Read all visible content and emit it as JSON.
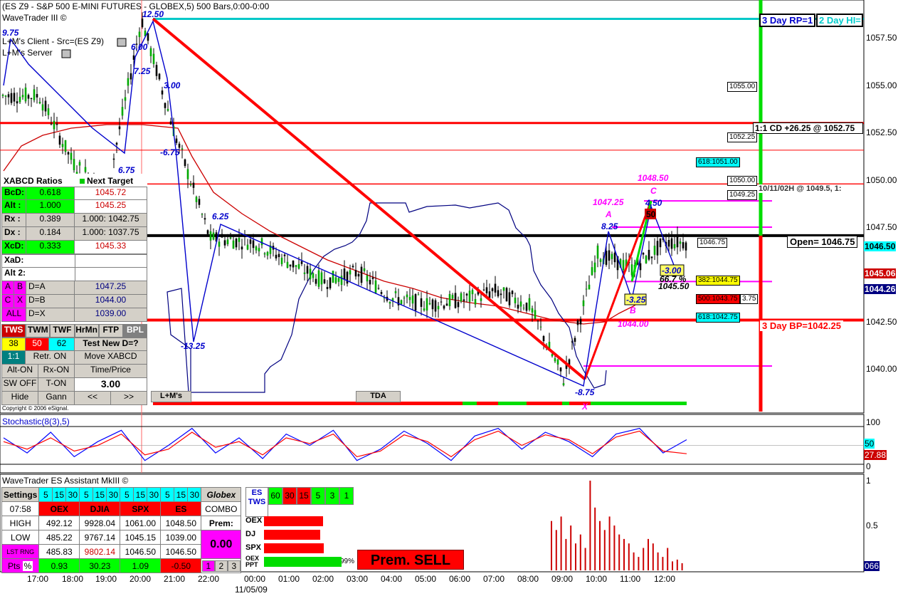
{
  "chart_data": [
    {
      "type": "line",
      "title": "(ES Z9 - S&P 500 E-MINI FUTURES - GLOBEX,5) 500 Bars,0:00-0:00",
      "xlabel": "",
      "ylabel": "",
      "ylim": [
        1037.6,
        1059.0
      ],
      "grid": false,
      "legend": "none",
      "x": [
        "17:00",
        "18:00",
        "19:00",
        "20:00",
        "21:00",
        "22:00",
        "00:00",
        "01:00",
        "02:00",
        "03:00",
        "04:00",
        "05:00",
        "06:00",
        "07:00",
        "08:00",
        "09:00",
        "10:00",
        "11:00",
        "12:00"
      ],
      "y_ticks": [
        "1057.50",
        "1055.00",
        "1052.50",
        "1050.00",
        "1047.50",
        "1046.50",
        "1045.06",
        "1044.26",
        "1042.50",
        "1040.00"
      ],
      "series": [
        {
          "name": "",
          "values": [
            1054.2,
            1050.6,
            1049.2,
            1058.3,
            1052.0,
            1046.6,
            1046.4,
            1045.3,
            1044.3,
            1044.8,
            1043.4,
            1043.1,
            1043.3,
            1043.8,
            1043.0,
            1039.1,
            1045.8,
            1045.0,
            1046.4
          ]
        }
      ],
      "levels": [
        {
          "label": "3 Day RP=1",
          "value": 1058.3,
          "color": "#00c8c8"
        },
        {
          "label": "2 Day HI=",
          "value": 1058.3,
          "color": "#00c8c8"
        },
        {
          "label": "1:1 CD +26.25 @ 1052.75",
          "value": 1052.75,
          "color": "#ff0000"
        },
        {
          "label": "10/11/02H @ 1049.5, 1:",
          "value": 1049.5,
          "color": "#ff0000"
        },
        {
          "label": "Open= 1046.75",
          "value": 1046.75,
          "color": "#000000"
        },
        {
          "label": "3 Day BP=1042.25",
          "value": 1042.25,
          "color": "#ff0000"
        }
      ],
      "annotations": [
        "12.50",
        "9.75",
        "6.00",
        "7.25",
        "3.00",
        "-6.75",
        "6.75",
        "6.25",
        "-13.25",
        "-8.75",
        "1047.25",
        "A",
        "8.25",
        "1048.50",
        "C",
        "4.50",
        "50",
        "-3.00",
        "66.7 %",
        "1045.50",
        "-3.25",
        "B",
        "1044.00",
        "X",
        "-3.25"
      ],
      "price_tags": [
        "1055.00",
        "1052.25",
        "618:1051.00",
        "1050.00",
        "1049.25",
        "1046.75",
        "382:1044.75",
        "500:1043.75",
        "3.75",
        "618:1042.75"
      ]
    },
    {
      "type": "line",
      "title": "Stochastic(8(3),5)",
      "xlabel": "",
      "ylabel": "",
      "ylim": [
        0,
        100
      ],
      "y_ticks": [
        "100",
        "50",
        "27.88",
        "0"
      ],
      "series": [
        {
          "name": "",
          "color": "#0000ff",
          "values": [
            70,
            30,
            85,
            20,
            60,
            90,
            10,
            50,
            95,
            30,
            70,
            15,
            80,
            50,
            90,
            10,
            40,
            88,
            55,
            10,
            75,
            95,
            40,
            85,
            60,
            20,
            80,
            95,
            30,
            65
          ]
        },
        {
          "name": "",
          "color": "#ff0000",
          "values": [
            60,
            40,
            70,
            35,
            50,
            80,
            25,
            40,
            85,
            45,
            60,
            25,
            70,
            55,
            80,
            20,
            35,
            78,
            60,
            20,
            65,
            88,
            50,
            78,
            65,
            28,
            72,
            88,
            35,
            28
          ]
        }
      ]
    },
    {
      "type": "bar",
      "title": "WaveTrader ES Assistant MkIII ©",
      "xlabel": "",
      "ylabel": "",
      "ylim": [
        0,
        1
      ],
      "y_ticks": [
        "1",
        "0.5",
        "066"
      ],
      "values": [
        0.55,
        0.45,
        0.6,
        0.35,
        0.5,
        0.3,
        0.4,
        0.25,
        1.0,
        0.7,
        0.55,
        0.45,
        0.6,
        0.5,
        0.4,
        0.35,
        0.3,
        0.2,
        0.15,
        0.25,
        0.35,
        0.3,
        0.2,
        0.15,
        0.25,
        0.1,
        0.12,
        0.08
      ]
    }
  ],
  "header": {
    "title": "(ES Z9 - S&P 500 E-MINI FUTURES - GLOBEX,5) 500 Bars,0:00-0:00",
    "app": "WaveTrader III ©",
    "client": "L+M's Client - Src=(ES Z9)",
    "server": "L+M's Server",
    "copyright": "Copyright © 2006 eSignal."
  },
  "bottom_buttons": {
    "lm": "L+M's",
    "tda": "TDA"
  },
  "xabcd": {
    "title": "XABCD Ratios",
    "next_target": "Next Target",
    "rows": [
      {
        "label": "BcD:",
        "ratio": "0.618",
        "target": "1045.72"
      },
      {
        "label": "Alt :",
        "ratio": "1.000",
        "target": "1045.25"
      },
      {
        "label": "Rx  :",
        "ratio": "0.389",
        "target": "1.000: 1042.75"
      },
      {
        "label": "Dx  :",
        "ratio": "0.184",
        "target": "1.000: 1037.75"
      },
      {
        "label": "XcD:",
        "ratio": "0.333",
        "target": "1045.33"
      }
    ],
    "xad": "XaD:",
    "alt2": "Alt 2:",
    "d_rows": [
      {
        "a": "A",
        "b": "B",
        "eq": "D=A",
        "val": "1047.25"
      },
      {
        "a": "C",
        "b": "X",
        "eq": "D=B",
        "val": "1044.00"
      },
      {
        "a": "ALL",
        "b": "",
        "eq": "D=X",
        "val": "1039.00"
      }
    ],
    "tabs": [
      "TWS",
      "TWM",
      "TWF",
      "HrMn",
      "FTP",
      "BPL"
    ],
    "fib": [
      "38",
      "50",
      "62"
    ],
    "test_new": "Test New D=?",
    "one_one": "1:1",
    "retr_on": "Retr. ON",
    "move_xabcd": "Move XABCD",
    "alt_on": "Alt-ON",
    "rx_on": "Rx-ON",
    "time_price": "Time/Price",
    "sw_off": "SW OFF",
    "t_on": "T-ON",
    "tp_value": "3.00",
    "hide": "Hide",
    "gann": "Gann",
    "prev": "<<",
    "next": ">>"
  },
  "assistant": {
    "title": "WaveTrader ES Assistant MkIII ©",
    "settings": "Settings",
    "intervals": [
      "5",
      "15",
      "30",
      "5",
      "15",
      "30",
      "5",
      "15",
      "30",
      "5",
      "15",
      "30"
    ],
    "globex": "Globex",
    "time": "07:58",
    "headers": [
      "OEX",
      "DJIA",
      "SPX",
      "ES"
    ],
    "combo": "COMBO",
    "rows": [
      {
        "label": "HIGH",
        "vals": [
          "492.12",
          "9928.04",
          "1061.00",
          "1048.50"
        ]
      },
      {
        "label": "LOW",
        "vals": [
          "485.22",
          "9767.14",
          "1045.15",
          "1039.00"
        ]
      },
      {
        "label": "LST RNG",
        "vals": [
          "485.83",
          "9802.14",
          "1046.50",
          "1046.50"
        ]
      }
    ],
    "pts": "Pts",
    "pct": "%",
    "pts_vals": [
      "0.93",
      "30.23",
      "1.09",
      "-0.50"
    ],
    "prem_label": "Prem:",
    "prem_value": "0.00",
    "combo_btns": [
      "1",
      "2",
      "3"
    ],
    "es_tws": "ES TWS",
    "tws_nums": [
      "60",
      "30",
      "15",
      "5",
      "3",
      "1"
    ],
    "bars": [
      {
        "label": "OEX",
        "fill": 0.75
      },
      {
        "label": "DJ",
        "fill": 0.72
      },
      {
        "label": "SPX",
        "fill": 0.76
      },
      {
        "label": "OEX PPT",
        "fill": 0.99,
        "pct": "99%"
      }
    ],
    "prem_sell": "Prem. SELL"
  },
  "time_axis": {
    "date": "11/05/09"
  },
  "colors": {
    "up": "#00aa00",
    "down": "#ff0000",
    "accent": "#0000cc",
    "magenta": "#ff00ff"
  }
}
